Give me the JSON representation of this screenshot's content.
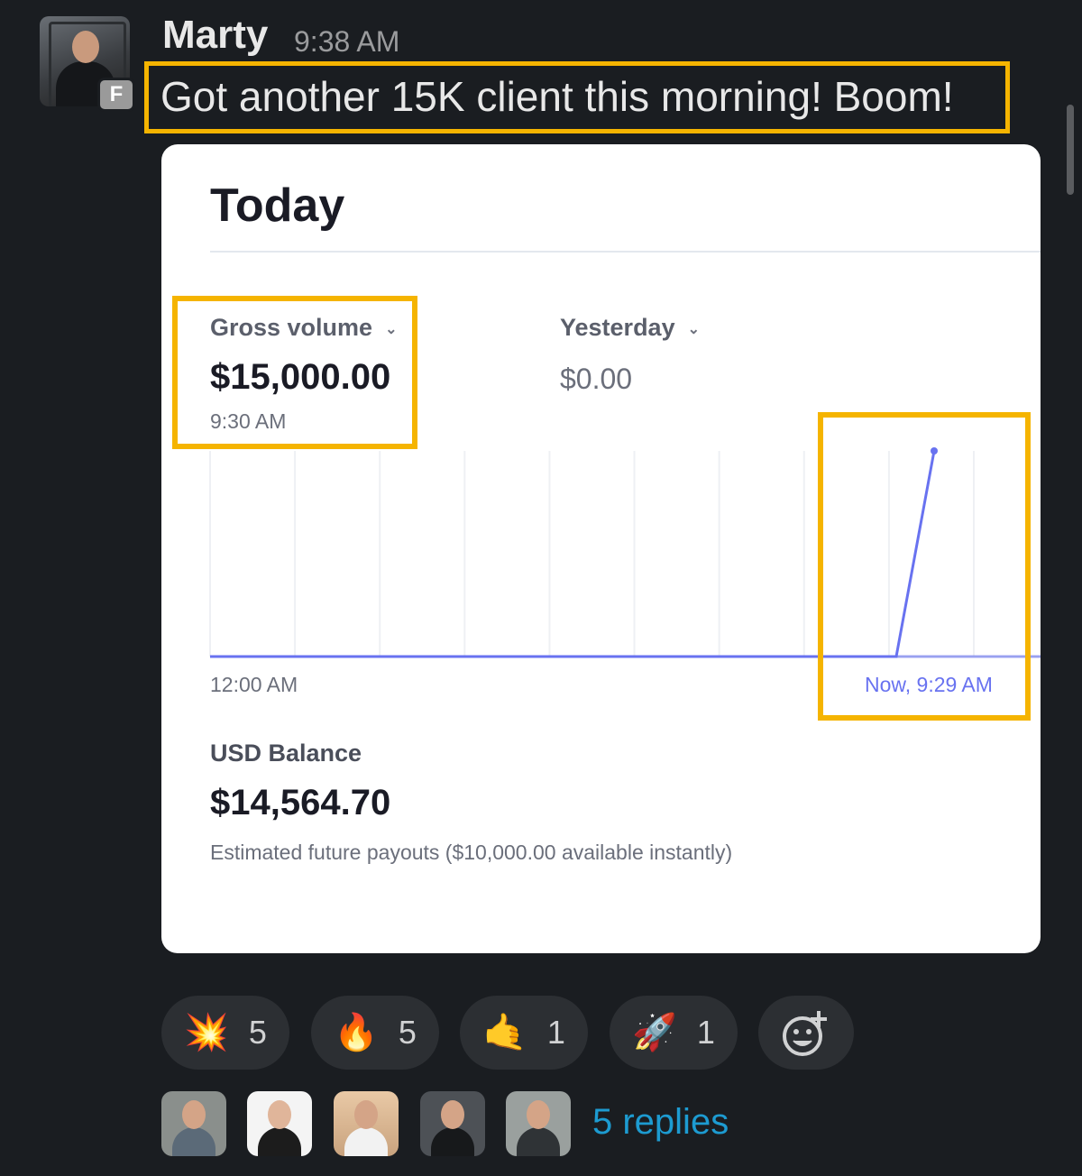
{
  "message": {
    "author": "Marty",
    "time": "9:38 AM",
    "badge": "F",
    "text": "Got another 15K client this morning! Boom!"
  },
  "card": {
    "title": "Today",
    "gross": {
      "label": "Gross volume",
      "value": "$15,000.00",
      "time": "9:30 AM"
    },
    "compare": {
      "label": "Yesterday",
      "value": "$0.00"
    },
    "axis": {
      "start": "12:00 AM",
      "end": "Now, 9:29 AM"
    },
    "balance": {
      "label": "USD Balance",
      "value": "$14,564.70",
      "note": "Estimated future payouts ($10,000.00 available instantly)"
    }
  },
  "chart_data": {
    "type": "line",
    "series": [
      {
        "values": [
          0,
          0,
          0,
          0,
          0,
          0,
          0,
          0,
          0,
          15000
        ]
      }
    ],
    "x_start": "12:00 AM",
    "x_end": "Now, 9:29 AM",
    "grid": true,
    "color": "#6872f0"
  },
  "reactions": [
    {
      "icon": "collision-icon",
      "emoji": "💥",
      "count": "5"
    },
    {
      "icon": "fire-icon",
      "emoji": "🔥",
      "count": "5"
    },
    {
      "icon": "call-me-hand-icon",
      "emoji": "🤙",
      "count": "1"
    },
    {
      "icon": "rocket-icon",
      "emoji": "🚀",
      "count": "1"
    }
  ],
  "replies": {
    "label": "5 replies",
    "avatars": [
      "avatar-1",
      "avatar-2",
      "avatar-3",
      "avatar-4",
      "avatar-5"
    ]
  },
  "colors": {
    "highlight": "#f5b400",
    "link": "#1d9bd1",
    "background": "#1a1d21"
  }
}
